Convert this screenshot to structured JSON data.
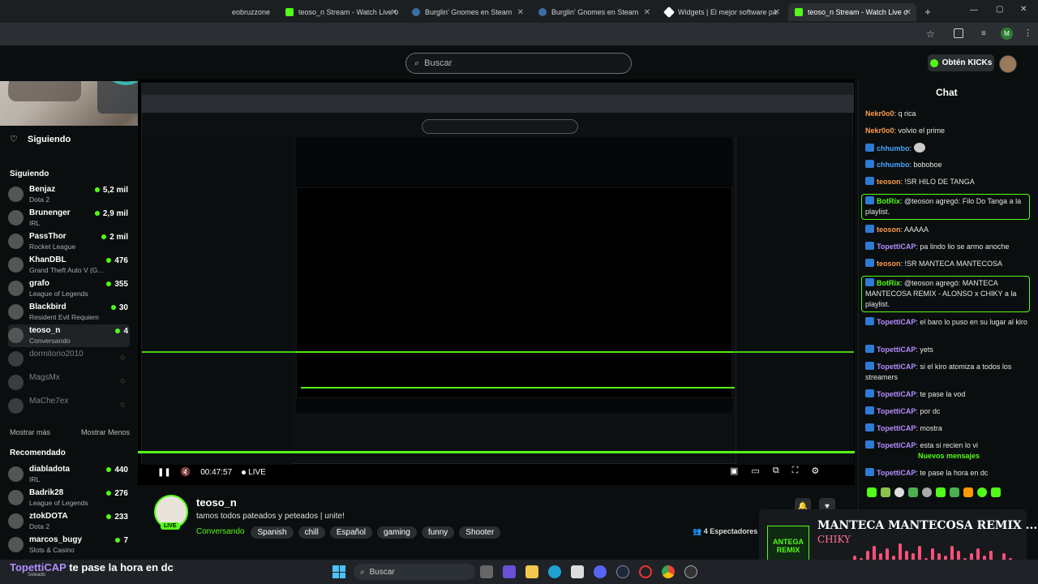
{
  "tabs": [
    {
      "label": "eobruzzone",
      "active": false
    },
    {
      "label": "teoso_n Stream - Watch Live o",
      "active": false
    },
    {
      "label": "Burglin' Gnomes en Steam",
      "active": false
    },
    {
      "label": "Burglin' Gnomes en Steam",
      "active": false
    },
    {
      "label": "Widgets | El mejor software pa",
      "active": false
    },
    {
      "label": "teoso_n Stream - Watch Live o",
      "active": true
    }
  ],
  "header": {
    "search_placeholder": "Buscar",
    "kicks_label": "Obtén KICKs"
  },
  "sidebar": {
    "following_title": "Siguiendo",
    "following_section": "Siguiendo",
    "following": [
      {
        "name": "Benjaz",
        "game": "Dota 2",
        "viewers": "5,2 mil",
        "live": true
      },
      {
        "name": "Brunenger",
        "game": "IRL",
        "viewers": "2,9 mil",
        "live": true
      },
      {
        "name": "PassThor",
        "game": "Rocket League",
        "viewers": "2 mil",
        "live": true
      },
      {
        "name": "KhanDBL",
        "game": "Grand Theft Auto V (G...",
        "viewers": "476",
        "live": true
      },
      {
        "name": "grafo",
        "game": "League of Legends",
        "viewers": "355",
        "live": true
      },
      {
        "name": "Blackbird",
        "game": "Resident Evil Requiem",
        "viewers": "30",
        "live": true
      },
      {
        "name": "teoso_n",
        "game": "Conversando",
        "viewers": "4",
        "live": true
      },
      {
        "name": "dormitorio2010",
        "game": "",
        "viewers": "",
        "live": false
      },
      {
        "name": "MagsMx",
        "game": "",
        "viewers": "",
        "live": false
      },
      {
        "name": "MaChe7ex",
        "game": "",
        "viewers": "",
        "live": false
      }
    ],
    "show_more": "Mostrar más",
    "show_less": "Mostrar Menos",
    "recommended_section": "Recomendado",
    "recommended": [
      {
        "name": "diabladota",
        "game": "IRL",
        "viewers": "440"
      },
      {
        "name": "Badrik28",
        "game": "League of Legends",
        "viewers": "276"
      },
      {
        "name": "ztokDOTA",
        "game": "Dota 2",
        "viewers": "233"
      },
      {
        "name": "marcos_bugy",
        "game": "Slots & Casino",
        "viewers": "7"
      }
    ]
  },
  "player": {
    "time": "00:47:57",
    "live": "LIVE",
    "overlay_caption_user": "TopettiCAP",
    "overlay_caption_text": "te pase la hora en dc",
    "overlay_caption_sub": "Soleado"
  },
  "stream": {
    "channel": "teoso_n",
    "title": "tamos todos pateados y peteados | unite!",
    "category": "Conversando",
    "tags": [
      "Spanish",
      "chill",
      "Español",
      "gaming",
      "funny",
      "Shooter"
    ],
    "live_badge": "LIVE",
    "viewers_label": "4 Espectadores"
  },
  "chat": {
    "title": "Chat",
    "new_messages": "Nuevos mensajes",
    "messages": [
      {
        "user": "Nekr0o0",
        "text": "q rica",
        "color": "#ff9a4a",
        "badge": false,
        "hl": false
      },
      {
        "user": "Nekr0o0",
        "text": "volvio el prime",
        "color": "#ff9a4a",
        "badge": false,
        "hl": false
      },
      {
        "user": "chhumbo",
        "text": "",
        "color": "#4aa3ff",
        "badge": true,
        "hl": false
      },
      {
        "user": "chhumbo",
        "text": "boboboe",
        "color": "#4aa3ff",
        "badge": true,
        "hl": false
      },
      {
        "user": "teoson",
        "text": "!SR HILO DE TANGA",
        "color": "#ff9a4a",
        "badge": true,
        "hl": false
      },
      {
        "user": "BotRix",
        "text": "@teoson agregó: Filo Do Tanga a la playlist.",
        "color": "#53fc18",
        "badge": true,
        "hl": true
      },
      {
        "user": "teoson",
        "text": "AAAAA",
        "color": "#ff9a4a",
        "badge": true,
        "hl": false
      },
      {
        "user": "TopettiCAP",
        "text": "pa lindo lio se armo anoche",
        "color": "#b48cff",
        "badge": true,
        "hl": false
      },
      {
        "user": "teoson",
        "text": "!SR MANTECA MANTECOSA",
        "color": "#ff9a4a",
        "badge": true,
        "hl": false
      },
      {
        "user": "BotRix",
        "text": "@teoson agregó: MANTECA MANTECOSA REMIX - ALONSO x CHIKY a la playlist.",
        "color": "#53fc18",
        "badge": true,
        "hl": true
      },
      {
        "user": "TopettiCAP",
        "text": "el baro lo puso en su lugar al kiro",
        "color": "#b48cff",
        "badge": true,
        "hl": false
      },
      {
        "user": "TopettiCAP",
        "text": "yets",
        "color": "#b48cff",
        "badge": true,
        "hl": false
      },
      {
        "user": "TopettiCAP",
        "text": "si el kiro atomiza a todos los streamers",
        "color": "#b48cff",
        "badge": true,
        "hl": false
      },
      {
        "user": "TopettiCAP",
        "text": "te pase la vod",
        "color": "#b48cff",
        "badge": true,
        "hl": false
      },
      {
        "user": "TopettiCAP",
        "text": "por dc",
        "color": "#b48cff",
        "badge": true,
        "hl": false
      },
      {
        "user": "TopettiCAP",
        "text": "mostra",
        "color": "#b48cff",
        "badge": true,
        "hl": false
      },
      {
        "user": "TopettiCAP",
        "text": "esta si recien lo vi",
        "color": "#b48cff",
        "badge": true,
        "hl": false
      }
    ],
    "after_new": {
      "user": "TopettiCAP",
      "text": "te pase la hora en dc",
      "color": "#b48cff"
    }
  },
  "now_playing": {
    "title": "MANTECA MANTECOSA REMIX ...",
    "artist": "CHIKY",
    "cover_text": "ANTEGA REMIX",
    "bar_levels": [
      0.3,
      0.5,
      0.4,
      0.7,
      0.9,
      0.6,
      0.8,
      0.5,
      1.0,
      0.7,
      0.6,
      0.9,
      0.4,
      0.8,
      0.6,
      0.5,
      0.9,
      0.7,
      0.4,
      0.6,
      0.8,
      0.5,
      0.7,
      0.3,
      0.6,
      0.4
    ]
  },
  "taskbar": {
    "search_label": "Buscar"
  },
  "colors": {
    "kick_green": "#53fc18",
    "bg": "#0b0e0f",
    "accent_pink": "#ff4f7a"
  }
}
